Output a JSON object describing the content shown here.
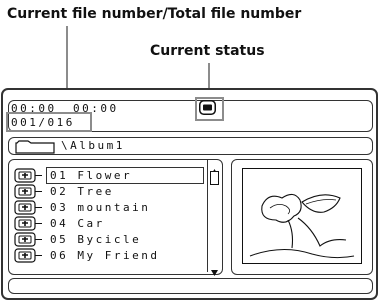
{
  "callouts": {
    "file_number": "Current file number/Total file number",
    "status": "Current status"
  },
  "status_bar": {
    "time_elapsed": "00:00",
    "time_total": "00:00",
    "file_counter": "001/016",
    "status_icon": "stop-icon"
  },
  "path": {
    "icon": "folder-icon",
    "text": "\\Album1"
  },
  "file_list": {
    "item_icon": "file-icon",
    "selected_index": 0,
    "items": [
      {
        "label": "01 Flower"
      },
      {
        "label": "02 Tree"
      },
      {
        "label": "03 mountain"
      },
      {
        "label": "04 Car"
      },
      {
        "label": "05 Bycicle"
      },
      {
        "label": "06 My Friend"
      }
    ]
  },
  "preview": {
    "icon": "image-thumbnail-icon"
  },
  "colors": {
    "outline": "#333333",
    "highlight_gray": "#8c8c8c"
  }
}
